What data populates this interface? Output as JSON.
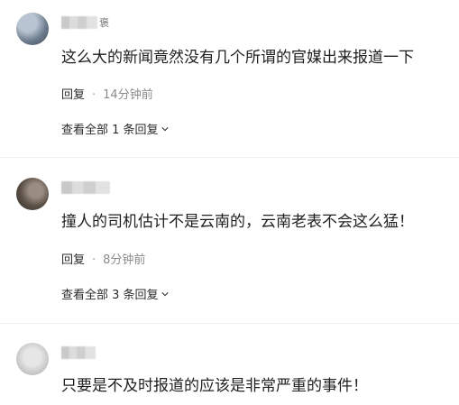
{
  "comments": [
    {
      "username_suffix": "褒",
      "text": "这么大的新闻竟然没有几个所谓的官媒出来报道一下",
      "reply_label": "回复",
      "time": "14分钟前",
      "expand_label": "查看全部 1 条回复"
    },
    {
      "text": "撞人的司机估计不是云南的，云南老表不会这么猛！",
      "reply_label": "回复",
      "time": "8分钟前",
      "expand_label": "查看全部 3 条回复"
    },
    {
      "text": "只要是不及时报道的应该是非常严重的事件！"
    }
  ],
  "icons": {
    "chevron": "chevron-down-icon"
  }
}
